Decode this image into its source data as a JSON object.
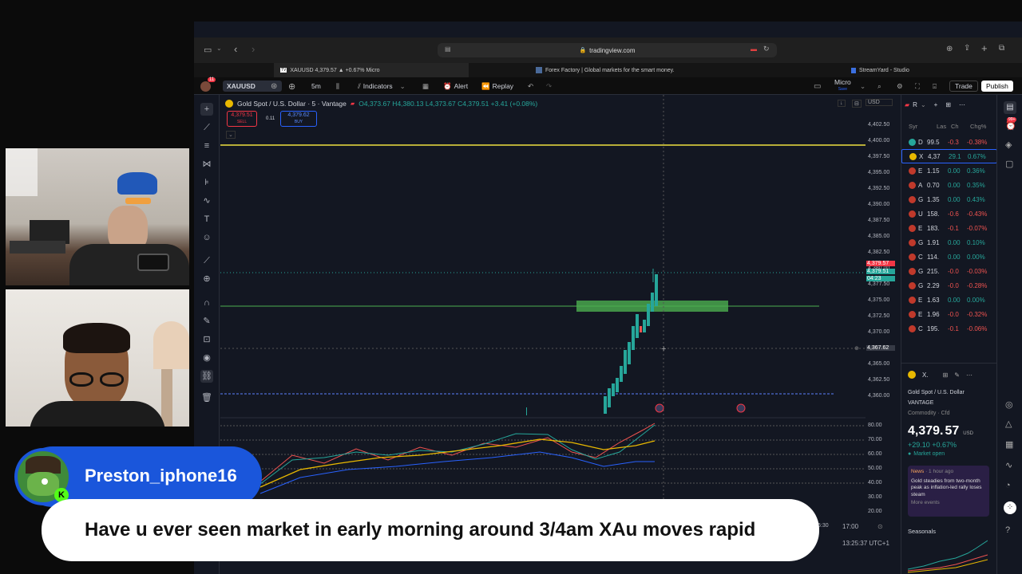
{
  "browser": {
    "url": "tradingview.com",
    "tabs": [
      {
        "label": "XAUUSD 4,379.57 ▲ +0.67% Micro",
        "icon": "tradingview-icon"
      },
      {
        "label": "Forex Factory | Global markets for the smart money.",
        "icon": "forexfactory-icon"
      },
      {
        "label": "StreamYard - Studio",
        "icon": "streamyard-icon"
      }
    ]
  },
  "toolbar": {
    "notif_count": "11",
    "symbol": "XAUUSD",
    "interval": "5m",
    "indicators": "Indicators",
    "alert": "Alert",
    "replay": "Replay",
    "account": "Micro",
    "account_sub": "Save",
    "trade": "Trade",
    "publish": "Publish"
  },
  "chart": {
    "title": "Gold Spot / U.S. Dollar · 5 · Vantage",
    "ohlc": "O4,373.67 H4,380.13 L4,373.67 C4,379.51 +3.41 (+0.08%)",
    "sell_price": "4,379.51",
    "sell_label": "SELL",
    "spread": "0.11",
    "buy_price": "4,379.62",
    "buy_label": "BUY",
    "currency": "USD",
    "price_labels": [
      "4,402.50",
      "4,400.00",
      "4,397.50",
      "4,395.00",
      "4,392.50",
      "4,390.00",
      "4,387.50",
      "4,385.00",
      "4,382.50",
      "4,380.00",
      "4,377.50",
      "4,375.00",
      "4,372.50",
      "4,370.00",
      "4,367.62",
      "4,365.00",
      "4,362.50",
      "4,360.00"
    ],
    "current_price_red": "4,379.57",
    "current_price_green": "4,379.51",
    "countdown": "04:23",
    "crosshair_price": "4,367.62",
    "rsi_labels": [
      "80.00",
      "70.00",
      "60.00",
      "50.00",
      "40.00",
      "30.00",
      "20.00"
    ],
    "time_label_partial": "6:30",
    "time_label": "17:00",
    "clock": "13:25:37 UTC+1"
  },
  "watchlist": {
    "title": "R",
    "col_symbol": "Syr",
    "col_last": "Las",
    "col_chg": "Ch",
    "col_chgp": "Chg%",
    "rows": [
      {
        "sym": "D",
        "last": "99.5",
        "chg": "-0.3",
        "chgp": "-0.38%",
        "up": false,
        "icon": "$"
      },
      {
        "sym": "X",
        "last": "4,37",
        "chg": "29.1",
        "chgp": "0.67%",
        "up": true,
        "icon": "au"
      },
      {
        "sym": "E",
        "last": "1.15",
        "chg": "0.00",
        "chgp": "0.36%",
        "up": true,
        "icon": "fx"
      },
      {
        "sym": "A",
        "last": "0.70",
        "chg": "0.00",
        "chgp": "0.35%",
        "up": true,
        "icon": "fx"
      },
      {
        "sym": "G",
        "last": "1.35",
        "chg": "0.00",
        "chgp": "0.43%",
        "up": true,
        "icon": "fx"
      },
      {
        "sym": "U",
        "last": "158.",
        "chg": "-0.6",
        "chgp": "-0.43%",
        "up": false,
        "icon": "fx"
      },
      {
        "sym": "E",
        "last": "183.",
        "chg": "-0.1",
        "chgp": "-0.07%",
        "up": false,
        "icon": "fx"
      },
      {
        "sym": "G",
        "last": "1.91",
        "chg": "0.00",
        "chgp": "0.10%",
        "up": true,
        "icon": "fx"
      },
      {
        "sym": "C",
        "last": "114.",
        "chg": "0.00",
        "chgp": "0.00%",
        "up": true,
        "icon": "fx"
      },
      {
        "sym": "G",
        "last": "215.",
        "chg": "-0.0",
        "chgp": "-0.03%",
        "up": false,
        "icon": "fx"
      },
      {
        "sym": "G",
        "last": "2.29",
        "chg": "-0.0",
        "chgp": "-0.28%",
        "up": false,
        "icon": "fx"
      },
      {
        "sym": "E",
        "last": "1.63",
        "chg": "0.00",
        "chgp": "0.00%",
        "up": true,
        "icon": "fx"
      },
      {
        "sym": "E",
        "last": "1.96",
        "chg": "-0.0",
        "chgp": "-0.32%",
        "up": false,
        "icon": "fx"
      },
      {
        "sym": "C",
        "last": "195.",
        "chg": "-0.1",
        "chgp": "-0.06%",
        "up": false,
        "icon": "fx"
      }
    ]
  },
  "details": {
    "symbol": "X.",
    "name": "Gold Spot / U.S. Dollar",
    "exchange": "VANTAGE",
    "type": "Commodity · Cfd",
    "price": "4,379.",
    "price_small": "57",
    "currency": "USD",
    "change": "+29.10 +0.67%",
    "status": "Market open",
    "news_tag": "News",
    "news_time": "· 1 hour ago",
    "news_text": "Gold steadies from two-month peak as inflation-led rally loses steam",
    "news_more": "More events",
    "seasonals": "Seasonals"
  },
  "rail": {
    "badge": "99+"
  },
  "stream": {
    "username": "Preston_iphone16",
    "message": "Have u ever seen market in early morning around 3/4am XAu moves rapid"
  },
  "colors": {
    "up": "#26a69a",
    "down": "#ef5350",
    "accent": "#2962ff",
    "yellow_line": "#f0e040",
    "green_line": "#4caf50"
  }
}
